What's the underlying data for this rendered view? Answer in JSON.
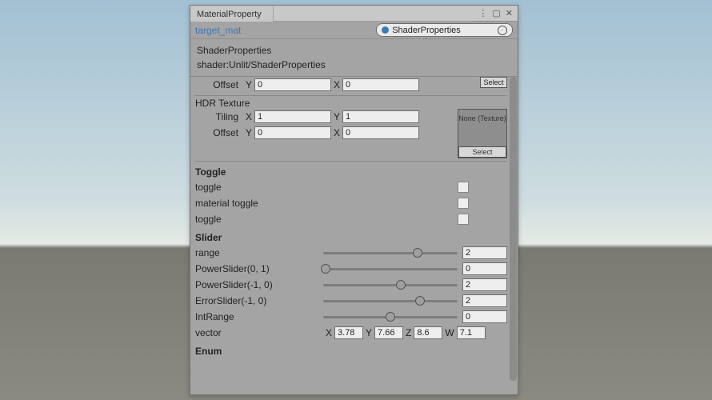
{
  "window": {
    "title": "MaterialProperty",
    "target_label": "target_mat",
    "obj_field": "ShaderProperties",
    "hdr_line1": "ShaderProperties",
    "hdr_line2": "shader:Unlit/ShaderProperties"
  },
  "top_tex": {
    "offset": {
      "label": "Offset",
      "y": "0",
      "x": "0"
    },
    "select": "Select"
  },
  "hdr_tex": {
    "label": "HDR Texture",
    "tiling": {
      "label": "Tiling",
      "x": "1",
      "y": "1"
    },
    "offset": {
      "label": "Offset",
      "y": "0",
      "x": "0"
    },
    "slot_text": "None (Texture)",
    "select": "Select"
  },
  "toggle": {
    "header": "Toggle",
    "items": [
      "toggle",
      "material toggle",
      "toggle"
    ]
  },
  "slider": {
    "header": "Slider",
    "range": {
      "label": "range",
      "value": "2",
      "pos": 70
    },
    "ps01": {
      "label": "PowerSlider(0, 1)",
      "value": "0",
      "pos": 2
    },
    "psm10": {
      "label": "PowerSlider(-1, 0)",
      "value": "2",
      "pos": 58
    },
    "err": {
      "label": "ErrorSlider(-1, 0)",
      "value": "2",
      "pos": 72
    },
    "intr": {
      "label": "IntRange",
      "value": "0",
      "pos": 50
    }
  },
  "vector": {
    "label": "vector",
    "x": "3.78",
    "y": "7.66",
    "z": "8.6",
    "w": "7.1"
  },
  "enum": {
    "header": "Enum"
  }
}
